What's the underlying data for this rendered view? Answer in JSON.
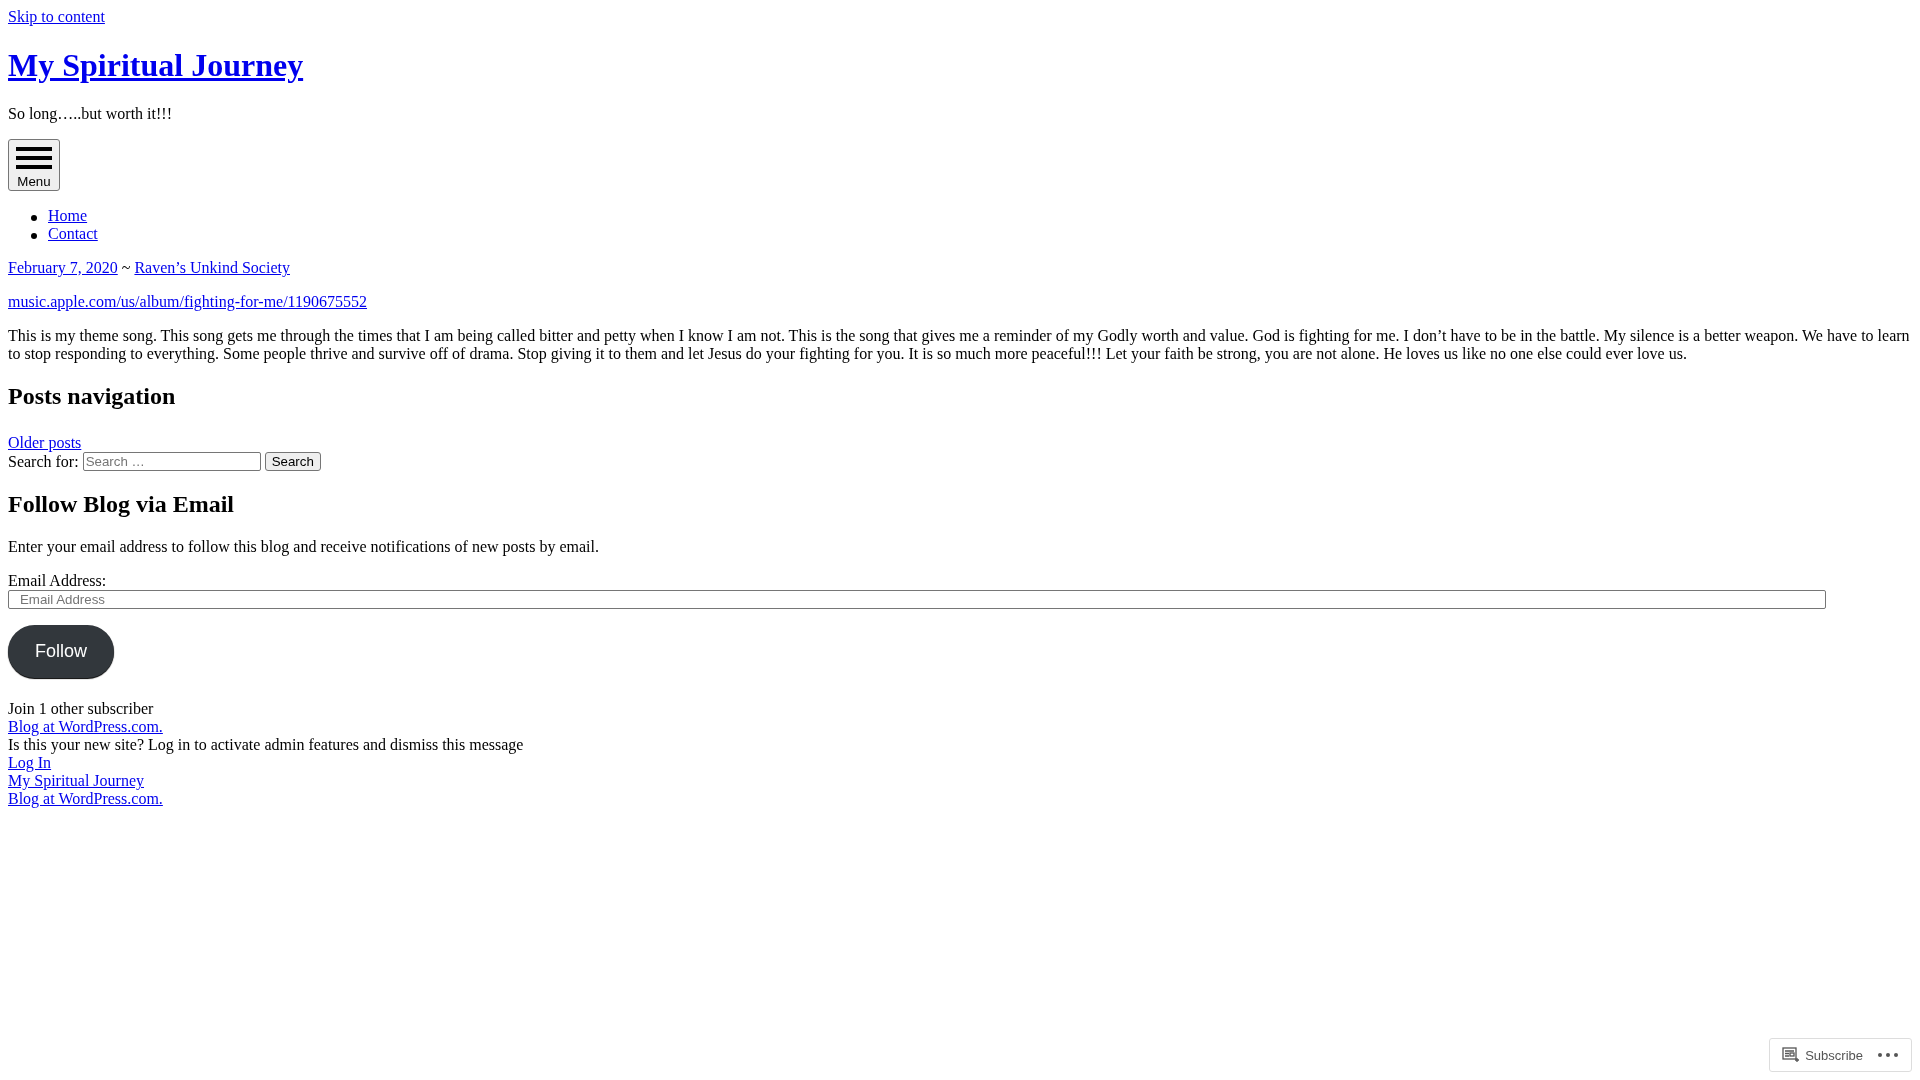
{
  "skip_link": "Skip to content",
  "site": {
    "title": "My Spiritual Journey",
    "tagline": "So long…..but worth it!!!"
  },
  "menu_button": {
    "label": "Menu"
  },
  "nav": [
    {
      "label": "Home"
    },
    {
      "label": "Contact"
    }
  ],
  "post": {
    "date": "February 7, 2020",
    "separator": "~",
    "author": "Raven’s Unkind Society",
    "link": "music.apple.com/us/album/fighting-for-me/1190675552",
    "body": "This is my theme song. This song gets me through the times that I am being called bitter and petty when I know I am not. This is the song that gives me a reminder of my Godly worth and value. God is fighting for me. I don’t have to be in the battle. My silence is a better weapon. We have to learn to stop responding to everything. Some people thrive and survive off of drama. Stop giving it to them and let Jesus do your fighting for you. It is so much more peaceful!!! Let your faith be strong, you are not alone. He loves us like no one else could ever love us."
  },
  "posts_nav": {
    "heading": "Posts navigation",
    "older": "Older posts"
  },
  "search": {
    "label": "Search for:",
    "placeholder": "Search …",
    "button": "Search"
  },
  "follow": {
    "heading": "Follow Blog via Email",
    "description": "Enter your email address to follow this blog and receive notifications of new posts by email.",
    "email_label": "Email Address:",
    "email_placeholder": "Email Address",
    "button": "Follow",
    "subscribers": "Join 1 other subscriber"
  },
  "footer": {
    "credit": "Blog at WordPress.com.",
    "notice": "Is this your new site? Log in to activate admin features and dismiss this message",
    "login": "Log In",
    "site_link": "My Spiritual Journey",
    "credit_2": "Blog at WordPress.com."
  },
  "subscribe_bar": {
    "label": "Subscribe"
  }
}
